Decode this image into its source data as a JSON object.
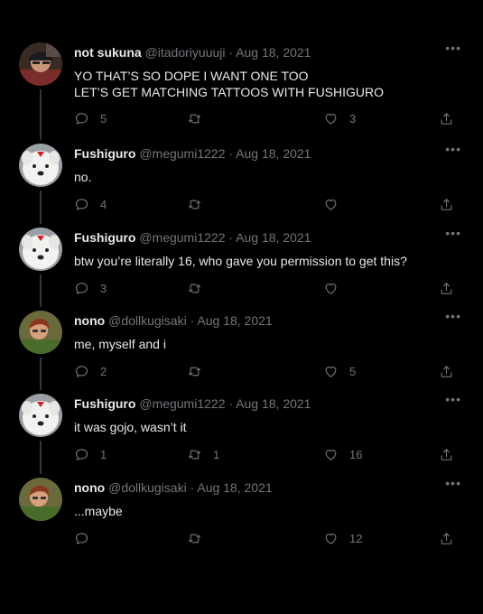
{
  "tweets": [
    {
      "name": "not sukuna",
      "handle": "@itadoriyuuuji",
      "separator": "·",
      "date": "Aug 18, 2021",
      "lines": [
        "YO THAT’S SO DOPE I WANT ONE TOO",
        "LET’S GET MATCHING TATTOOS WITH FUSHIGURO"
      ],
      "replies": "5",
      "retweets": "",
      "likes": "3",
      "avatar": "cap-boy"
    },
    {
      "name": "Fushiguro",
      "handle": "@megumi1222",
      "separator": "·",
      "date": "Aug 18, 2021",
      "lines": [
        "no."
      ],
      "replies": "4",
      "retweets": "",
      "likes": "",
      "avatar": "white-dog"
    },
    {
      "name": "Fushiguro",
      "handle": "@megumi1222",
      "separator": "·",
      "date": "Aug 18, 2021",
      "lines": [
        "btw you’re literally 16, who gave you permission to get this?"
      ],
      "replies": "3",
      "retweets": "",
      "likes": "",
      "avatar": "white-dog"
    },
    {
      "name": "nono",
      "handle": "@dollkugisaki",
      "separator": "·",
      "date": "Aug 18, 2021",
      "lines": [
        "me, myself and i"
      ],
      "replies": "2",
      "retweets": "",
      "likes": "5",
      "avatar": "red-hair"
    },
    {
      "name": "Fushiguro",
      "handle": "@megumi1222",
      "separator": "·",
      "date": "Aug 18, 2021",
      "lines": [
        "it was gojo, wasn’t it"
      ],
      "replies": "1",
      "retweets": "1",
      "likes": "16",
      "avatar": "white-dog"
    },
    {
      "name": "nono",
      "handle": "@dollkugisaki",
      "separator": "·",
      "date": "Aug 18, 2021",
      "lines": [
        "...maybe"
      ],
      "replies": "",
      "retweets": "",
      "likes": "12",
      "avatar": "red-hair"
    }
  ],
  "more_label": "•••",
  "icons": {
    "reply": "reply-icon",
    "retweet": "retweet-icon",
    "like": "heart-icon",
    "share": "share-icon",
    "more": "more-icon"
  },
  "colors": {
    "background": "#000000",
    "text": "#e7e9ea",
    "muted": "#71767b",
    "thread_line": "#333639"
  }
}
